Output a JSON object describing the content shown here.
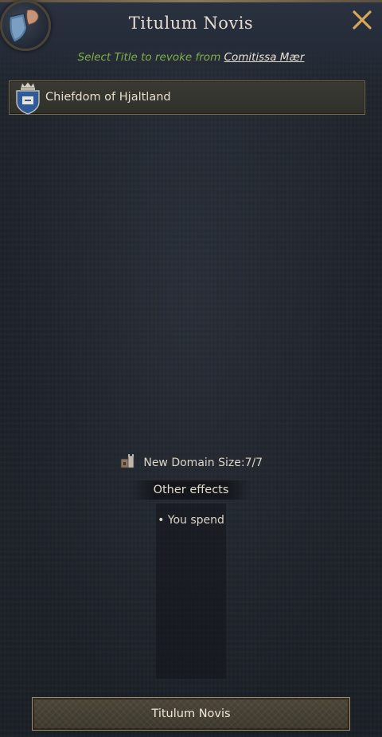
{
  "window": {
    "title": "Titulum Novis",
    "close_icon": "close-icon"
  },
  "subtitle": {
    "lead": "Select Title to revoke from",
    "target": "Comitissa Mær"
  },
  "titles": [
    {
      "label": "Chiefdom of Hjaltland",
      "icon": "coat-of-arms-icon"
    }
  ],
  "effects": {
    "domain_label": "New Domain Size:",
    "domain_value": "7/7",
    "other_effects_label": "Other effects",
    "spend_text": "• You spend"
  },
  "confirm": {
    "label": "Titulum Novis"
  },
  "colors": {
    "accent_green": "#7fb04a",
    "frame_gold": "#a08c63",
    "background": "#1c2028"
  }
}
